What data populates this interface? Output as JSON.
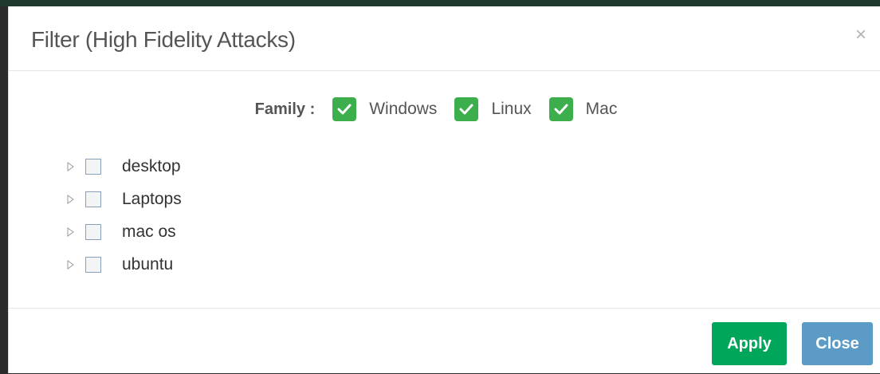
{
  "modal": {
    "title": "Filter (High Fidelity Attacks)",
    "close_glyph": "×"
  },
  "family": {
    "label": "Family :",
    "options": [
      {
        "label": "Windows",
        "checked": true
      },
      {
        "label": "Linux",
        "checked": true
      },
      {
        "label": "Mac",
        "checked": true
      }
    ]
  },
  "tree": {
    "nodes": [
      {
        "label": "desktop",
        "checked": false,
        "expander_icon": "triangle-right-icon"
      },
      {
        "label": "Laptops",
        "checked": false,
        "expander_icon": "triangle-right-icon"
      },
      {
        "label": "mac os",
        "checked": false,
        "expander_icon": "triangle-right-icon"
      },
      {
        "label": "ubuntu",
        "checked": false,
        "expander_icon": "triangle-right-icon"
      }
    ]
  },
  "footer": {
    "apply_label": "Apply",
    "close_label": "Close"
  },
  "colors": {
    "checkbox_green": "#3cae4b",
    "apply_button": "#00a65a",
    "close_button": "#5b9bc6"
  }
}
